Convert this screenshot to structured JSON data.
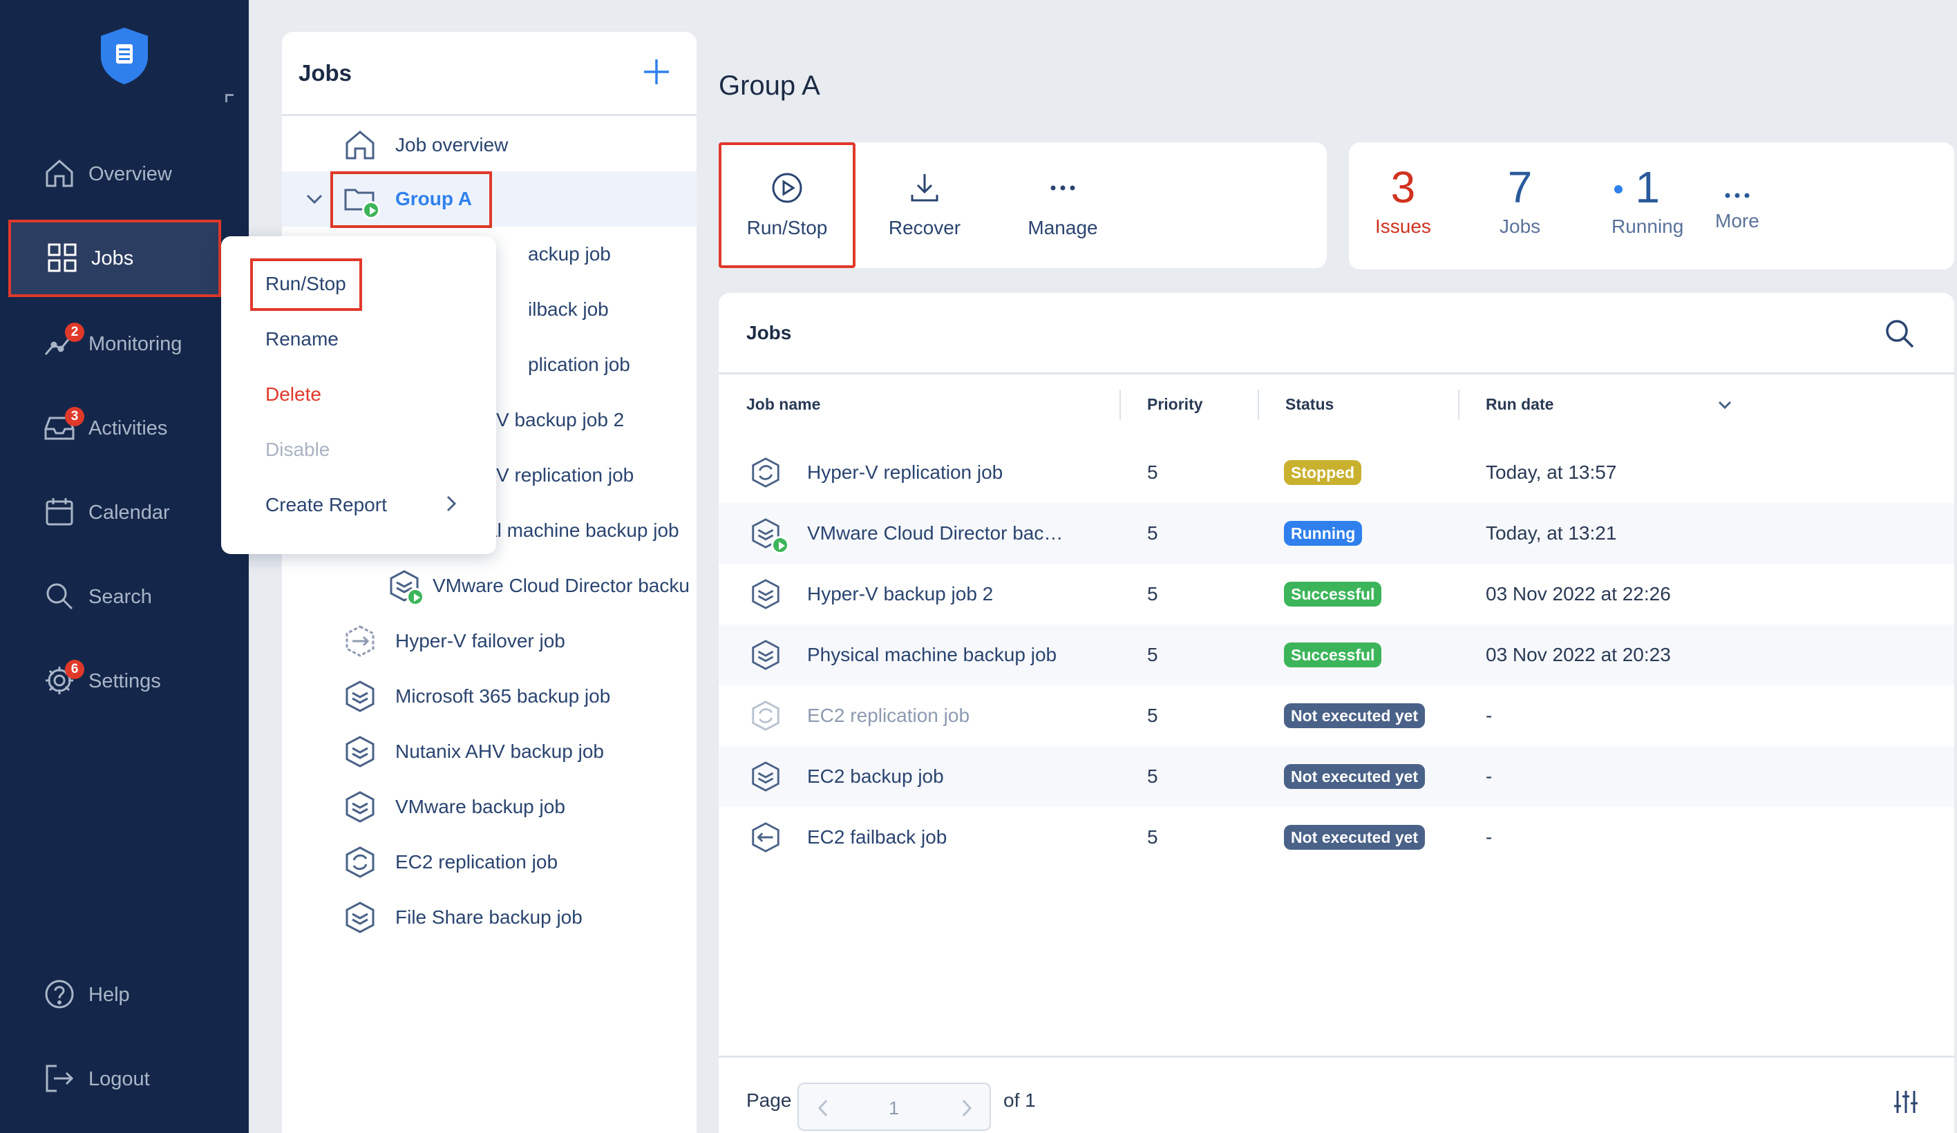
{
  "sidebar": {
    "items": [
      {
        "label": "Overview",
        "icon": "home-icon"
      },
      {
        "label": "Jobs",
        "icon": "grid-icon",
        "active": true
      },
      {
        "label": "Monitoring",
        "icon": "chart-icon",
        "badge": "2"
      },
      {
        "label": "Activities",
        "icon": "inbox-icon",
        "badge": "3"
      },
      {
        "label": "Calendar",
        "icon": "calendar-icon"
      },
      {
        "label": "Search",
        "icon": "search-icon"
      },
      {
        "label": "Settings",
        "icon": "gear-icon",
        "badge": "6"
      }
    ],
    "bottom": [
      {
        "label": "Help",
        "icon": "help-icon"
      },
      {
        "label": "Logout",
        "icon": "logout-icon"
      }
    ]
  },
  "tree": {
    "title": "Jobs",
    "items": [
      {
        "label": "Job overview"
      },
      {
        "label": "Group A"
      },
      {
        "label": "ackup job"
      },
      {
        "label": "ilback job"
      },
      {
        "label": "plication job"
      },
      {
        "label": "V backup job 2"
      },
      {
        "label": "V replication job"
      },
      {
        "label": "al machine backup job"
      },
      {
        "label": "VMware Cloud Director backu"
      },
      {
        "label": "Hyper-V failover job"
      },
      {
        "label": "Microsoft 365 backup job"
      },
      {
        "label": "Nutanix AHV backup job"
      },
      {
        "label": "VMware backup job"
      },
      {
        "label": "EC2 replication job"
      },
      {
        "label": "File Share backup job"
      }
    ]
  },
  "context_menu": {
    "items": [
      "Run/Stop",
      "Rename",
      "Delete",
      "Disable",
      "Create Report"
    ]
  },
  "main": {
    "title": "Group A",
    "toolbar": [
      "Run/Stop",
      "Recover",
      "Manage"
    ],
    "stats": {
      "issues": {
        "value": "3",
        "label": "Issues"
      },
      "jobs": {
        "value": "7",
        "label": "Jobs"
      },
      "running": {
        "value": "1",
        "label": "Running"
      },
      "more": "More"
    },
    "jobs_card": {
      "title": "Jobs",
      "columns": [
        "Job name",
        "Priority",
        "Status",
        "Run date"
      ],
      "rows": [
        {
          "name": "Hyper-V replication job",
          "priority": "5",
          "status": "Stopped",
          "date": "Today, at 13:57"
        },
        {
          "name": "VMware Cloud Director bac…",
          "priority": "5",
          "status": "Running",
          "date": "Today, at 13:21"
        },
        {
          "name": "Hyper-V backup job 2",
          "priority": "5",
          "status": "Successful",
          "date": "03 Nov 2022 at 22:26"
        },
        {
          "name": "Physical machine backup job",
          "priority": "5",
          "status": "Successful",
          "date": "03 Nov 2022 at 20:23"
        },
        {
          "name": "EC2 replication job",
          "priority": "5",
          "status": "Not executed yet",
          "date": "-"
        },
        {
          "name": "EC2 backup job",
          "priority": "5",
          "status": "Not executed yet",
          "date": "-"
        },
        {
          "name": "EC2 failback job",
          "priority": "5",
          "status": "Not executed yet",
          "date": "-"
        }
      ],
      "pager": {
        "label": "Page",
        "current": "1",
        "of": "of 1"
      }
    }
  },
  "colors": {
    "sidebar_bg": "#14274a",
    "accent_red": "#e0392a",
    "stopped": "#c9b12f",
    "running": "#2f80ed",
    "successful": "#3cb55a",
    "not_executed": "#4a6288"
  }
}
